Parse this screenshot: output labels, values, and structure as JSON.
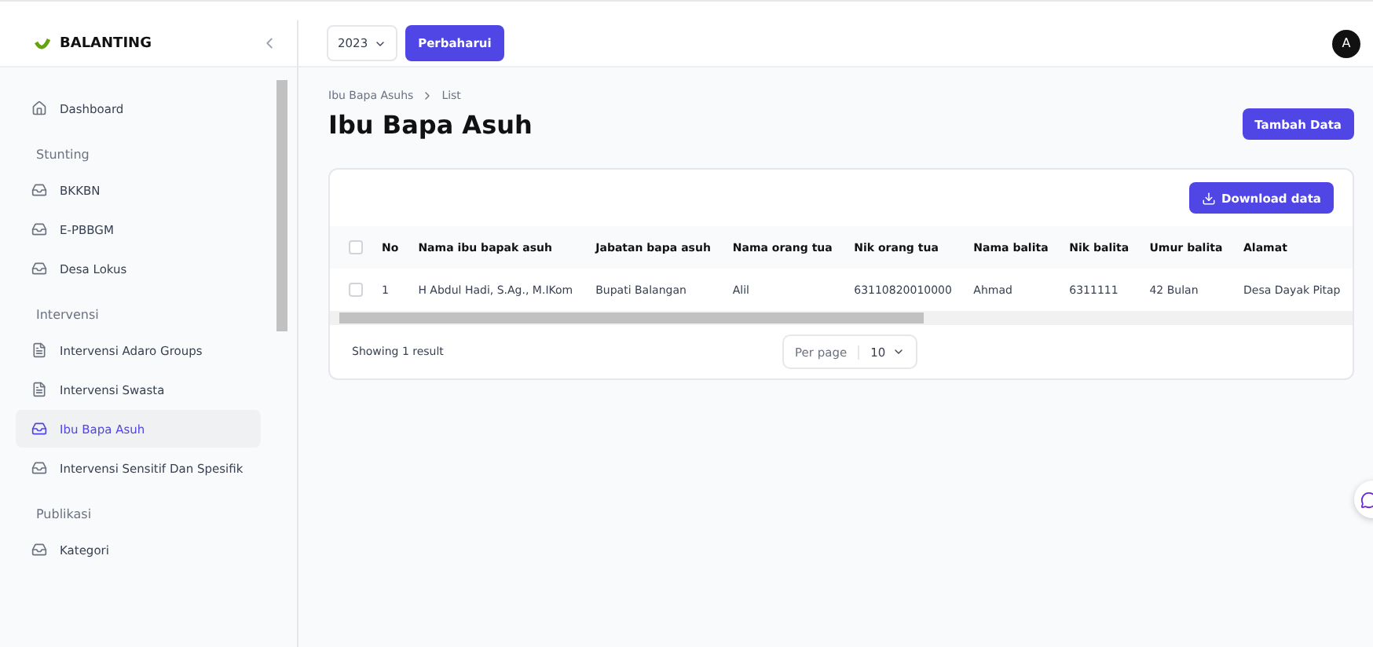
{
  "brand": {
    "name": "BALANTING"
  },
  "sidebar": {
    "sections": [
      {
        "items": [
          {
            "label": "Dashboard",
            "kind": "home",
            "selected": false
          }
        ]
      },
      {
        "title": "Stunting",
        "items": [
          {
            "label": "BKKBN",
            "kind": "tray",
            "selected": false
          },
          {
            "label": "E-PBBGM",
            "kind": "tray",
            "selected": false
          },
          {
            "label": "Desa Lokus",
            "kind": "tray",
            "selected": false
          }
        ]
      },
      {
        "title": "Intervensi",
        "items": [
          {
            "label": "Intervensi Adaro Groups",
            "kind": "file",
            "selected": false
          },
          {
            "label": "Intervensi Swasta",
            "kind": "file",
            "selected": false
          },
          {
            "label": "Ibu Bapa Asuh",
            "kind": "tray",
            "selected": true
          },
          {
            "label": "Intervensi Sensitif Dan Spesifik",
            "kind": "tray",
            "selected": false
          }
        ]
      },
      {
        "title": "Publikasi",
        "items": [
          {
            "label": "Kategori",
            "kind": "tray",
            "selected": false
          }
        ]
      }
    ]
  },
  "topbar": {
    "year": "2023",
    "update_button": "Perbaharui",
    "avatar": "A"
  },
  "breadcrumb": [
    "Ibu Bapa Asuhs",
    "List"
  ],
  "page_title": "Ibu Bapa Asuh",
  "add_button": "Tambah Data",
  "download_button": "Download data",
  "table": {
    "columns": [
      "No",
      "Nama ibu bapak asuh",
      "Jabatan bapa asuh",
      "Nama orang tua",
      "Nik orang tua",
      "Nama balita",
      "Nik balita",
      "Umur balita",
      "Alamat"
    ],
    "header_checked": false,
    "rows": [
      {
        "checked": false,
        "cells": [
          "1",
          "H Abdul Hadi, S.Ag., M.IKom",
          "Bupati Balangan",
          "Alil",
          "63110820010000",
          "Ahmad",
          "6311111",
          "42 Bulan",
          "Desa Dayak Pitap"
        ]
      }
    ]
  },
  "footer": {
    "summary": "Showing 1 result",
    "per_page_label": "Per page",
    "per_page": "10"
  }
}
